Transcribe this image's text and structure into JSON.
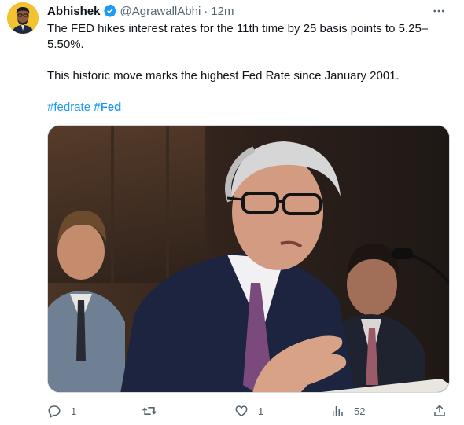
{
  "author": {
    "name": "Abhishek",
    "handle": "@AgrawallAbhi",
    "separator": "·",
    "time": "12m"
  },
  "tweet": {
    "line1": "The FED hikes interest rates for the 11th time by 25 basis points to 5.25–5.50%.",
    "line2": "This historic move marks the highest Fed Rate since January 2001.",
    "hashtags": [
      "#fedrate",
      "#Fed"
    ]
  },
  "media": {
    "alt": "Man in glasses speaking at a microphone"
  },
  "actions": {
    "replies": "1",
    "retweets": "",
    "likes": "1",
    "views": "52"
  },
  "colors": {
    "accent": "#1d9bf0",
    "muted": "#536471",
    "text": "#0f1419"
  },
  "icons": [
    "verified-badge-icon",
    "more-icon",
    "reply-icon",
    "retweet-icon",
    "like-icon",
    "views-icon",
    "share-icon"
  ]
}
